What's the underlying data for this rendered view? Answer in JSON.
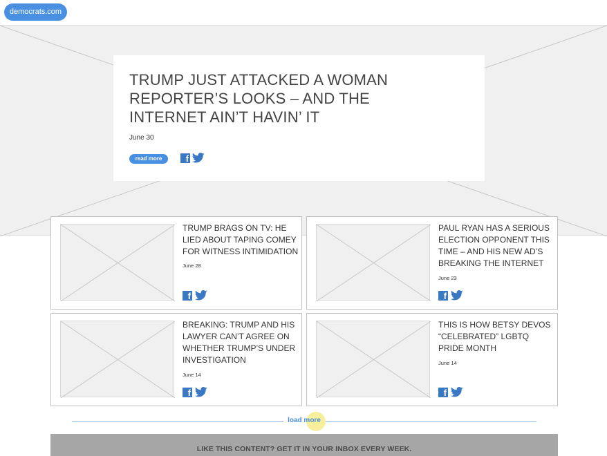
{
  "header": {
    "logo_label": "democrats.com"
  },
  "hero": {
    "title": "TRUMP JUST ATTACKED A WOMAN REPORTER’S LOOKS – AND THE INTERNET AIN’T HAVIN’ IT",
    "date": "June 30",
    "read_more_label": "read more"
  },
  "articles": [
    {
      "title": "TRUMP BRAGS ON TV: HE LIED ABOUT TAPING COMEY FOR WITNESS INTIMIDATION",
      "date": "June 28"
    },
    {
      "title": "PAUL RYAN HAS A SERIOUS ELECTION OPPONENT THIS TIME – AND HIS NEW AD’S BREAKING THE INTERNET",
      "date": "June 23"
    },
    {
      "title": "BREAKING: TRUMP AND HIS LAWYER CAN’T AGREE ON WHETHER TRUMP’S UNDER INVESTIGATION",
      "date": "June 14"
    },
    {
      "title": "THIS IS HOW BETSY DEVOS “CELEBRATED” LGBTQ PRIDE MONTH",
      "date": "June 14"
    }
  ],
  "load_more_label": "load more",
  "footer": {
    "cta_text": "LIKE THIS CONTENT? GET IT IN YOUR INBOX EVERY WEEK."
  },
  "icons": {
    "facebook": "facebook-icon",
    "twitter": "twitter-icon"
  },
  "colors": {
    "accent": "#4a90e2",
    "placeholder": "#f0f0f0",
    "footer": "#a6a6a6",
    "highlight": "#f7ef9c"
  }
}
